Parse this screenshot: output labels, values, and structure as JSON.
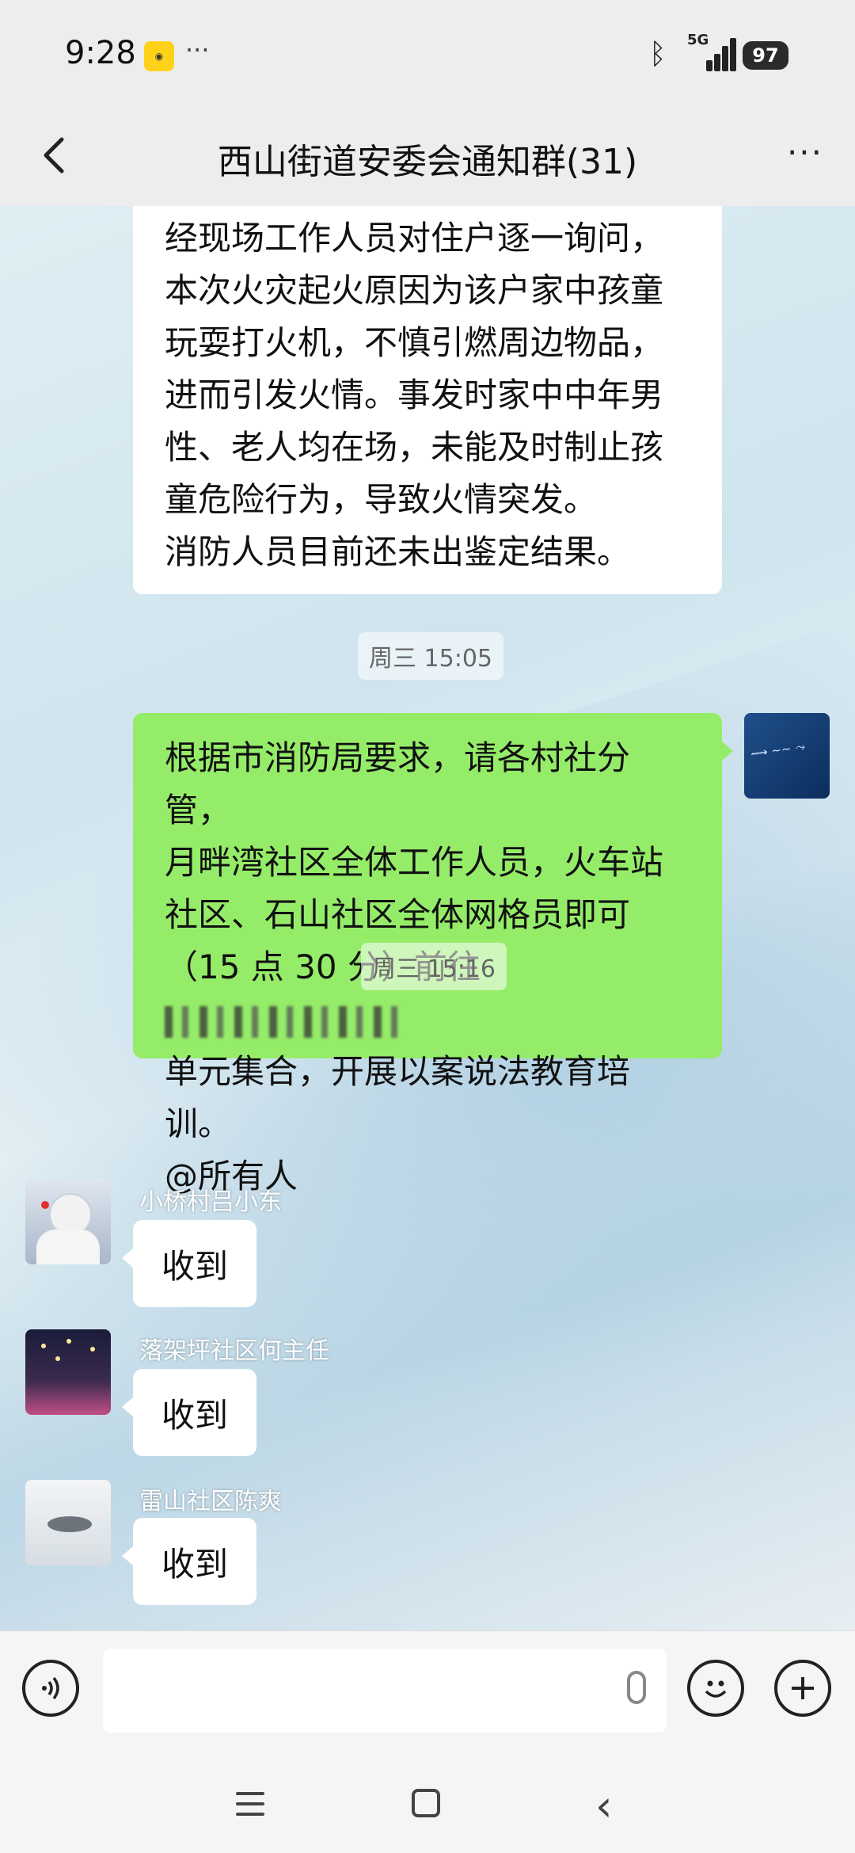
{
  "status_bar": {
    "time": "9:28",
    "more": "···",
    "network": "5G",
    "battery": "97"
  },
  "header": {
    "title": "西山街道安委会通知群(31)",
    "more": "···"
  },
  "messages": {
    "incoming_long": {
      "lines": [
        "经现场工作人员对住户逐一询问，",
        "本次火灾起火原因为该户家中孩童",
        "玩耍打火机，不慎引燃周边物品，",
        "进而引发火情。事发时家中中年男",
        "性、老人均在场，未能及时制止孩",
        "童危险行为，导致火情突发。",
        "消防人员目前还未出鉴定结果。"
      ]
    },
    "time1": "周三 15:05",
    "outgoing": {
      "lines": [
        "根据市消防局要求，请各村社分管，",
        "月畔湾社区全体工作人员，火车站",
        "社区、石山社区全体网格员即可",
        "（15 点 30 分）前往",
        "单元集合，开展以案说法教育培训。",
        "@所有人"
      ]
    },
    "time2": "周三 15:16",
    "replies": [
      {
        "name": "小桥村吕小东",
        "text": "收到"
      },
      {
        "name": "落架坪社区何主任",
        "text": "收到"
      },
      {
        "name": "雷山社区陈爽",
        "text": "收到"
      }
    ]
  },
  "colors": {
    "outgoing_bubble": "#95ec69",
    "incoming_bubble": "#ffffff"
  },
  "icons": [
    "back-icon",
    "more-icon",
    "voice-icon",
    "mic-icon",
    "emoji-icon",
    "plus-icon"
  ]
}
